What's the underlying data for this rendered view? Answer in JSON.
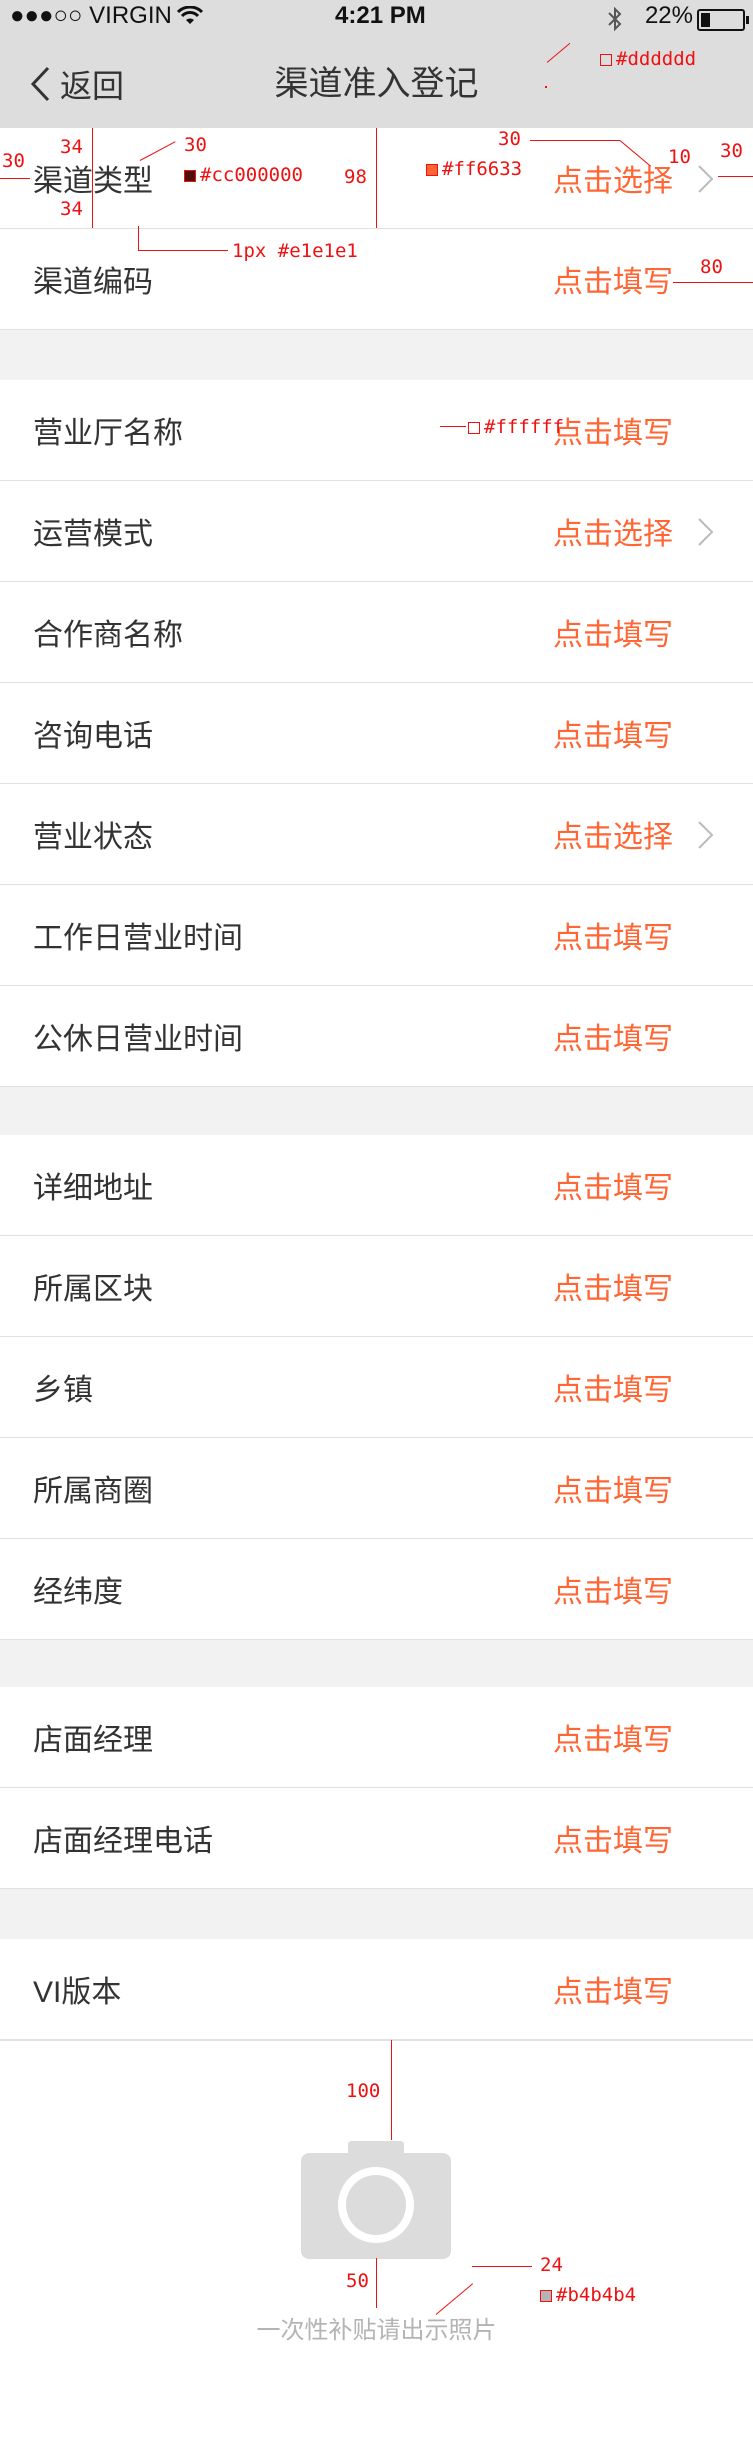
{
  "status_bar": {
    "carrier": "●●●○○ VIRGIN",
    "time": "4:21 PM",
    "battery": "22%",
    "battery_level": 0.22
  },
  "nav": {
    "back_label": "返回",
    "title": "渠道准入登记"
  },
  "sections": [
    [
      {
        "label": "渠道类型",
        "action": "点击选择",
        "chevron": true
      },
      {
        "label": "渠道编码",
        "action": "点击填写",
        "chevron": false
      }
    ],
    [
      {
        "label": "营业厅名称",
        "action": "点击填写",
        "chevron": false
      },
      {
        "label": "运营模式",
        "action": "点击选择",
        "chevron": true
      },
      {
        "label": "合作商名称",
        "action": "点击填写",
        "chevron": false
      },
      {
        "label": "咨询电话",
        "action": "点击填写",
        "chevron": false
      },
      {
        "label": "营业状态",
        "action": "点击选择",
        "chevron": true
      },
      {
        "label": "工作日营业时间",
        "action": "点击填写",
        "chevron": false
      },
      {
        "label": "公休日营业时间",
        "action": "点击填写",
        "chevron": false
      }
    ],
    [
      {
        "label": "详细地址",
        "action": "点击填写",
        "chevron": false
      },
      {
        "label": "所属区块",
        "action": "点击填写",
        "chevron": false
      },
      {
        "label": "乡镇",
        "action": "点击填写",
        "chevron": false
      },
      {
        "label": "所属商圈",
        "action": "点击填写",
        "chevron": false
      },
      {
        "label": "经纬度",
        "action": "点击填写",
        "chevron": false
      }
    ],
    [
      {
        "label": "店面经理",
        "action": "点击填写",
        "chevron": false
      },
      {
        "label": "店面经理电话",
        "action": "点击填写",
        "chevron": false
      }
    ],
    [
      {
        "label": "VI版本",
        "action": "点击填写",
        "chevron": false
      }
    ]
  ],
  "upload": {
    "hint": "一次性补贴请出示照片"
  },
  "colors": {
    "nav_bg": "#dddddd",
    "label": "#cc000000",
    "action": "#ff6633",
    "divider": "#e1e1e1",
    "row_bg": "#ffffff",
    "hint": "#b4b4b4"
  },
  "annotations": {
    "nav_color": "#dddddd",
    "label_color": "#cc000000",
    "action_color": "#ff6633",
    "divider": "1px #e1e1e1",
    "row_bg": "#ffffff",
    "hint_color": "#b4b4b4",
    "left_pad": "30",
    "font_size": "30",
    "pad_top": "34",
    "pad_bottom": "34",
    "row_height": "98",
    "action_font": "30",
    "chev_gap": "10",
    "chev_right": "30",
    "action_right": "80",
    "cam_top": "100",
    "cam_gap": "50",
    "hint_size": "24"
  }
}
